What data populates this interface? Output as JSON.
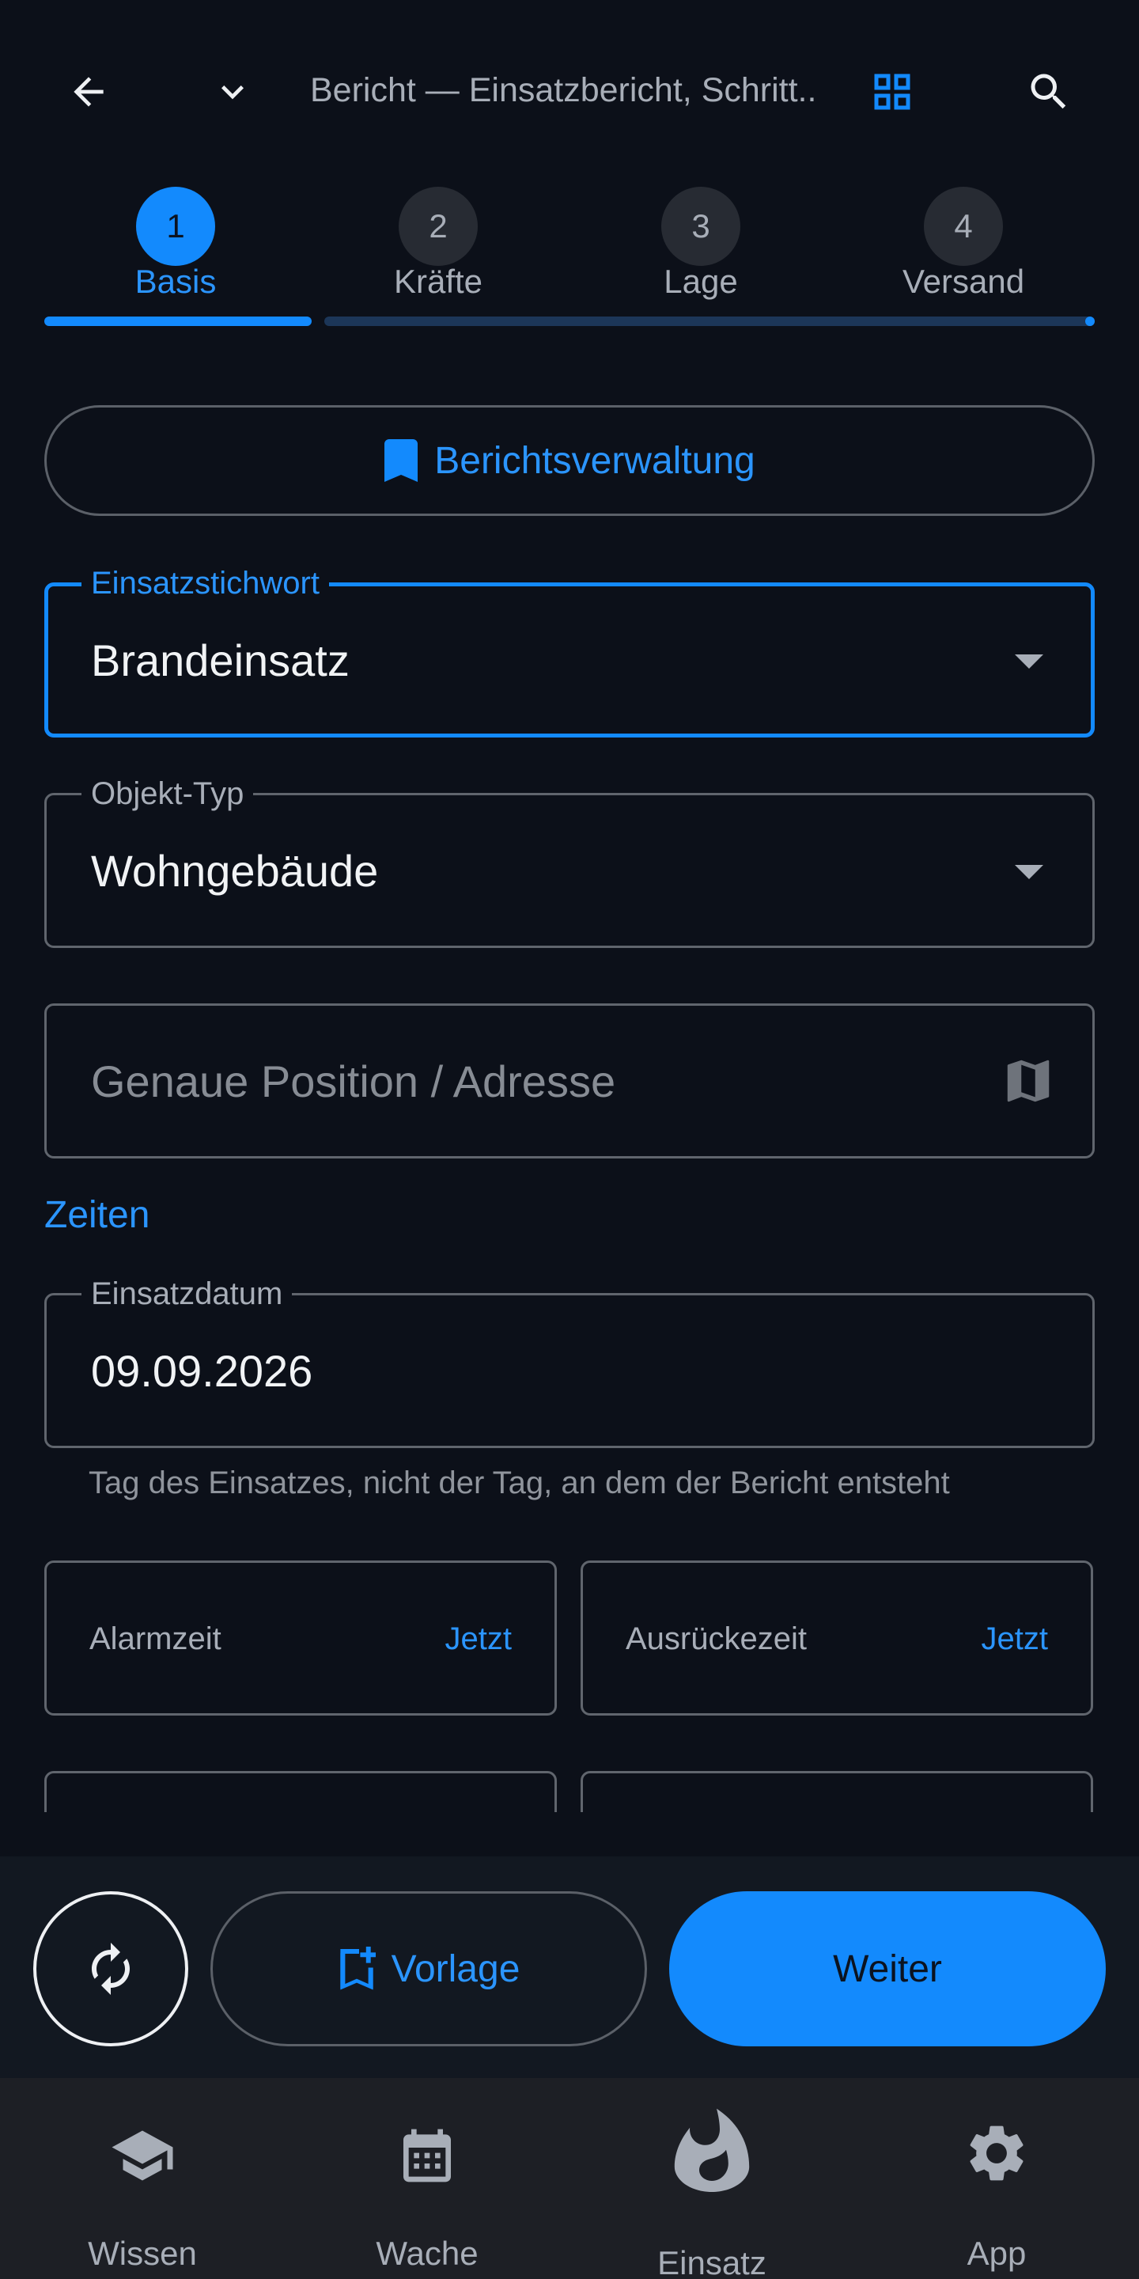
{
  "header": {
    "title": "Bericht — Einsatzbericht, Schritt..."
  },
  "stepper": {
    "steps": [
      {
        "number": "1",
        "label": "Basis"
      },
      {
        "number": "2",
        "label": "Kräfte"
      },
      {
        "number": "3",
        "label": "Lage"
      },
      {
        "number": "4",
        "label": "Versand"
      }
    ],
    "active_step": 1,
    "progress_fraction": 0.25
  },
  "report_management": {
    "label": "Berichtsverwaltung"
  },
  "form": {
    "keyword": {
      "label": "Einsatzstichwort",
      "value": "Brandeinsatz"
    },
    "object_type": {
      "label": "Objekt-Typ",
      "value": "Wohngebäude"
    },
    "position": {
      "placeholder": "Genaue Position / Adresse"
    },
    "times_section": "Zeiten",
    "date": {
      "label": "Einsatzdatum",
      "value": "09.09.2026",
      "helper": "Tag des Einsatzes, nicht der Tag, an dem der Bericht entsteht"
    },
    "alarm_time": {
      "label": "Alarmzeit",
      "action": "Jetzt"
    },
    "departure_time": {
      "label": "Ausrückezeit",
      "action": "Jetzt"
    }
  },
  "actions": {
    "template_label": "Vorlage",
    "next_label": "Weiter"
  },
  "bottom_nav": {
    "items": [
      {
        "label": "Wissen",
        "icon": "school-icon"
      },
      {
        "label": "Wache",
        "icon": "calendar-icon"
      },
      {
        "label": "Einsatz",
        "icon": "fire-icon"
      },
      {
        "label": "App",
        "icon": "gear-icon"
      }
    ]
  },
  "colors": {
    "accent": "#138afd",
    "background": "#0c1019",
    "action_bar": "#121821",
    "nav_bar": "#1d1f25"
  }
}
